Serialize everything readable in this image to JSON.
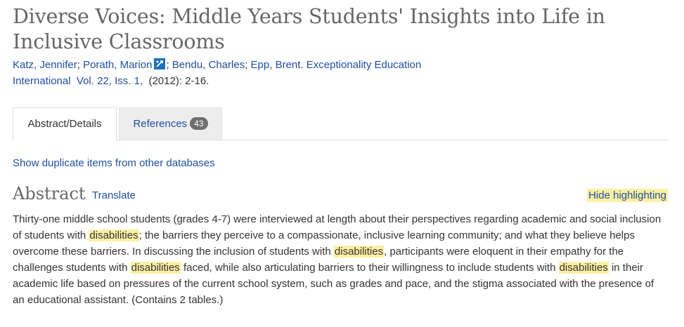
{
  "title": "Diverse Voices: Middle Years Students' Insights into Life in Inclusive Classrooms",
  "citation": {
    "authors": [
      {
        "name": "Katz, Jennifer",
        "sep": "; "
      },
      {
        "name": "Porath, Marion",
        "sep": ""
      },
      {
        "name": "Bendu, Charles",
        "sep": "; "
      },
      {
        "name": "Epp, Brent",
        "sep": ". "
      }
    ],
    "author_sep_after_icon": "; ",
    "journal": "Exceptionality Education International",
    "volume": "Vol. 22, Iss. 1,",
    "date_pages": "(2012): 2-16."
  },
  "tabs": {
    "abstract_label": "Abstract/Details",
    "references_label": "References",
    "references_count": "43"
  },
  "duplicate_link": "Show duplicate items from other databases",
  "abstract": {
    "heading": "Abstract",
    "translate_label": "Translate",
    "hide_highlighting_label": "Hide highlighting",
    "highlight_term": "disabilities",
    "segments": [
      "Thirty-one middle school students (grades 4-7) were interviewed at length about their perspectives regarding academic and social inclusion of students with ",
      "; the barriers they perceive to a compassionate, inclusive learning community; and what they believe helps overcome these barriers. In discussing the inclusion of students with ",
      ", participants were eloquent in their empathy for the challenges students with ",
      " faced, while also articulating barriers to their willingness to include students with ",
      " in their academic life based on pressures of the current school system, such as grades and pace, and the stigma associated with the presence of an educational assistant. (Contains 2 tables.)"
    ]
  },
  "colors": {
    "link": "#1f4fa0",
    "highlight": "#fbf0a3",
    "heading": "#666666"
  }
}
